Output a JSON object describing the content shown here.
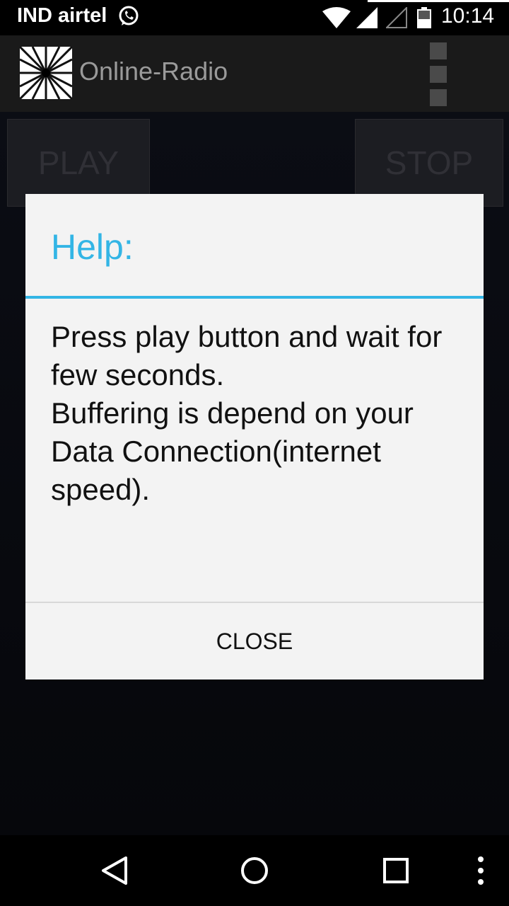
{
  "status_bar": {
    "carrier": "IND airtel",
    "time": "10:14"
  },
  "app_bar": {
    "title": "Online-Radio"
  },
  "controls": {
    "play_label": "PLAY",
    "stop_label": "STOP"
  },
  "dialog": {
    "title": "Help:",
    "message": "Press play button and wait for few seconds.\nBuffering is depend on your Data Connection(internet speed).",
    "close_label": "CLOSE"
  },
  "colors": {
    "accent": "#33b5e5",
    "dialog_background": "#f3f3f3",
    "app_bar": "#1a1a1a"
  },
  "icons": {
    "status": [
      "whatsapp-icon",
      "wifi-icon",
      "signal-icon",
      "signal-empty-icon",
      "battery-icon"
    ],
    "navigation": [
      "back-icon",
      "home-icon",
      "recent-apps-icon",
      "more-icon"
    ]
  }
}
